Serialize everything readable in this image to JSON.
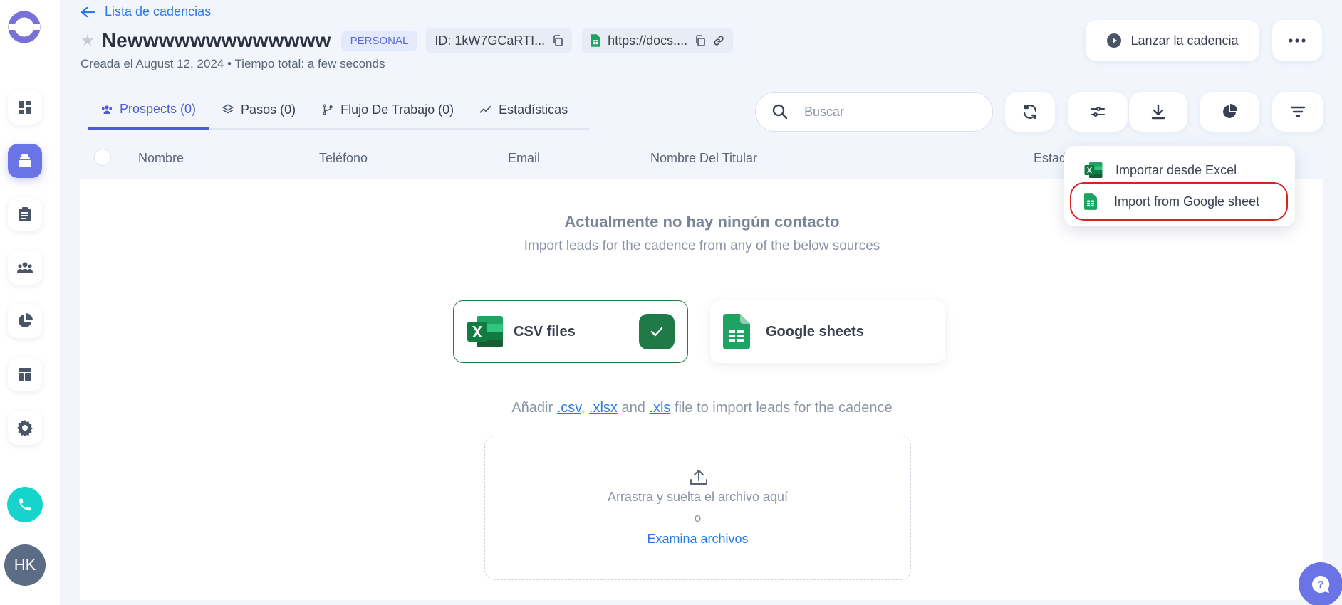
{
  "header": {
    "back_label": "Lista de cadencias",
    "title": "Newwwwwwwwwwwww",
    "badge": "PERSONAL",
    "id_chip": "ID: 1kW7GCaRTI...",
    "url_chip": "https://docs....",
    "created": "Creada el August 12, 2024 • Tiempo total: a few seconds",
    "launch_label": "Lanzar la cadencia"
  },
  "tabs": [
    {
      "label": "Prospects (0)",
      "icon": "users-icon"
    },
    {
      "label": "Pasos (0)",
      "icon": "layers-icon"
    },
    {
      "label": "Flujo De Trabajo (0)",
      "icon": "branch-icon"
    },
    {
      "label": "Estadísticas",
      "icon": "trend-icon"
    }
  ],
  "search": {
    "placeholder": "Buscar"
  },
  "table": {
    "columns": [
      "Nombre",
      "Teléfono",
      "Email",
      "Nombre Del Titular",
      "Estado"
    ]
  },
  "empty": {
    "title": "Actualmente no hay ningún contacto",
    "subtitle": "Import leads for the cadence from any of the below sources"
  },
  "sources": {
    "csv": "CSV files",
    "gsheets": "Google sheets"
  },
  "add_line": {
    "prefix": "Añadir ",
    "csv": ".csv",
    "sep1": ", ",
    "xlsx": ".xlsx",
    "and": " and ",
    "xls": ".xls",
    "suffix": " file to import leads for the cadence"
  },
  "dropzone": {
    "text": "Arrastra y suelta el archivo aquí",
    "or": "o",
    "browse": "Examina archivos"
  },
  "dropdown": {
    "items": [
      "Importar desde Excel",
      "Import from Google sheet"
    ]
  },
  "user": {
    "initials": "HK"
  },
  "colors": {
    "accent": "#4b5bd3",
    "excel_green": "#1f7a48",
    "sheets_green": "#1ea362",
    "highlight": "#d9231f"
  }
}
